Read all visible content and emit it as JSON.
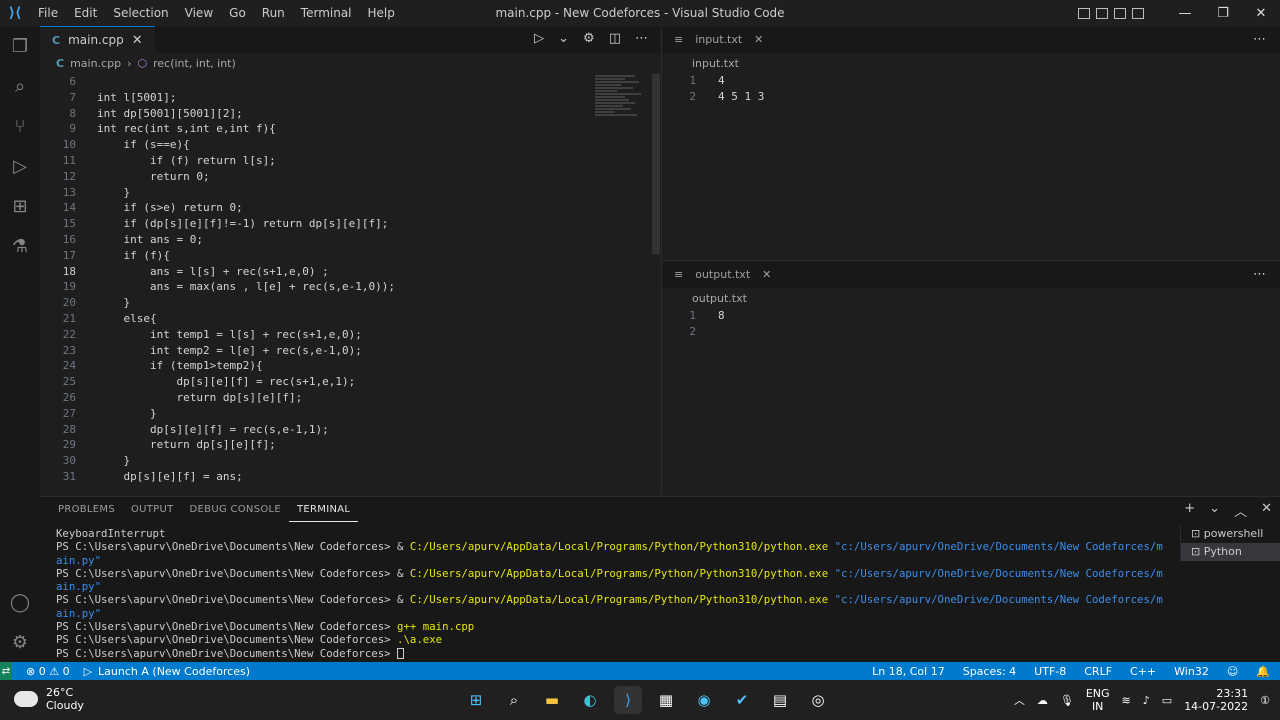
{
  "window": {
    "title": "main.cpp - New Codeforces - Visual Studio Code",
    "menu": [
      "File",
      "Edit",
      "Selection",
      "View",
      "Go",
      "Run",
      "Terminal",
      "Help"
    ]
  },
  "editor": {
    "tab_label": "main.cpp",
    "breadcrumb_file": "main.cpp",
    "breadcrumb_symbol": "rec(int, int, int)",
    "lines": [
      {
        "n": "6",
        "t": ""
      },
      {
        "n": "7",
        "t": "int l[5001];"
      },
      {
        "n": "8",
        "t": "int dp[5001][5001][2];"
      },
      {
        "n": "9",
        "t": "int rec(int s,int e,int f){"
      },
      {
        "n": "10",
        "t": "    if (s==e){"
      },
      {
        "n": "11",
        "t": "        if (f) return l[s];"
      },
      {
        "n": "12",
        "t": "        return 0;"
      },
      {
        "n": "13",
        "t": "    }"
      },
      {
        "n": "14",
        "t": "    if (s>e) return 0;"
      },
      {
        "n": "15",
        "t": "    if (dp[s][e][f]!=-1) return dp[s][e][f];"
      },
      {
        "n": "16",
        "t": "    int ans = 0;"
      },
      {
        "n": "17",
        "t": "    if (f){"
      },
      {
        "n": "18",
        "t": "        ans = l[s] + rec(s+1,e,0) ;"
      },
      {
        "n": "19",
        "t": "        ans = max(ans , l[e] + rec(s,e-1,0));"
      },
      {
        "n": "20",
        "t": "    }"
      },
      {
        "n": "21",
        "t": "    else{"
      },
      {
        "n": "22",
        "t": "        int temp1 = l[s] + rec(s+1,e,0);"
      },
      {
        "n": "23",
        "t": "        int temp2 = l[e] + rec(s,e-1,0);"
      },
      {
        "n": "24",
        "t": "        if (temp1>temp2){"
      },
      {
        "n": "25",
        "t": "            dp[s][e][f] = rec(s+1,e,1);"
      },
      {
        "n": "26",
        "t": "            return dp[s][e][f];"
      },
      {
        "n": "27",
        "t": "        }"
      },
      {
        "n": "28",
        "t": "        dp[s][e][f] = rec(s,e-1,1);"
      },
      {
        "n": "29",
        "t": "        return dp[s][e][f];"
      },
      {
        "n": "30",
        "t": "    }"
      },
      {
        "n": "31",
        "t": "    dp[s][e][f] = ans;"
      }
    ]
  },
  "input_pane": {
    "tab_label": "input.txt",
    "breadcrumb": "input.txt",
    "lines": [
      {
        "n": "1",
        "t": "4"
      },
      {
        "n": "2",
        "t": "4 5 1 3"
      }
    ]
  },
  "output_pane": {
    "tab_label": "output.txt",
    "breadcrumb": "output.txt",
    "lines": [
      {
        "n": "1",
        "t": "8"
      },
      {
        "n": "2",
        "t": ""
      }
    ]
  },
  "panel": {
    "tabs": [
      "PROBLEMS",
      "OUTPUT",
      "DEBUG CONSOLE",
      "TERMINAL"
    ],
    "terminals": [
      "powershell",
      "Python"
    ],
    "prompt": "PS C:\\Users\\apurv\\OneDrive\\Documents\\New Codeforces>",
    "keyboard_interrupt": "KeyboardInterrupt",
    "python_exe": "C:/Users/apurv/AppData/Local/Programs/Python/Python310/python.exe",
    "script_path_a": "\"c:/Users/apurv/OneDrive/Documents/New Codeforces/m",
    "script_path_b": "ain.py\"",
    "cmd_compile": "g++ main.cpp",
    "cmd_run": ".\\a.exe"
  },
  "status": {
    "problems": "⊗ 0 ⚠ 0",
    "launch": "Launch A (New Codeforces)",
    "position": "Ln 18, Col 17",
    "spaces": "Spaces: 4",
    "encoding": "UTF-8",
    "eol": "CRLF",
    "language": "C++",
    "platform": "Win32"
  },
  "taskbar": {
    "temp": "26°C",
    "weather": "Cloudy",
    "lang": "ENG",
    "region": "IN",
    "time": "23:31",
    "date": "14-07-2022"
  }
}
